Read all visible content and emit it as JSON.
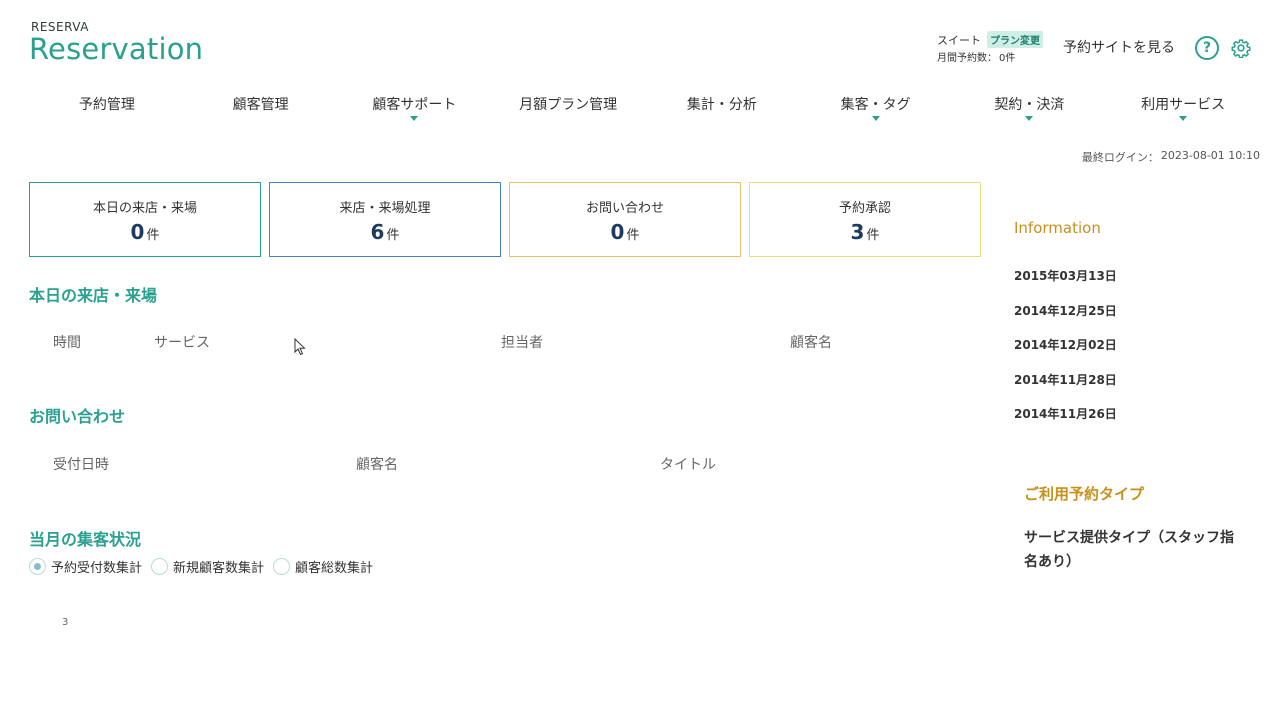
{
  "brand": {
    "small": "RESERVA",
    "big": "Reservation"
  },
  "plan": {
    "name": "スイート",
    "change_label": "プラン変更",
    "monthly_label": "月間予約数：",
    "monthly_value": "0件"
  },
  "header": {
    "view_site": "予約サイトを見る",
    "help_glyph": "?"
  },
  "nav": [
    {
      "label": "予約管理",
      "has_dropdown": false
    },
    {
      "label": "顧客管理",
      "has_dropdown": false
    },
    {
      "label": "顧客サポート",
      "has_dropdown": true
    },
    {
      "label": "月額プラン管理",
      "has_dropdown": false
    },
    {
      "label": "集計・分析",
      "has_dropdown": false
    },
    {
      "label": "集客・タグ",
      "has_dropdown": true
    },
    {
      "label": "契約・決済",
      "has_dropdown": true
    },
    {
      "label": "利用サービス",
      "has_dropdown": true
    }
  ],
  "last_login": {
    "label": "最終ログイン：",
    "value": "2023-08-01 10:10"
  },
  "cards": [
    {
      "label": "本日の来店・来場",
      "value": "0",
      "unit": "件",
      "border": "#2aa190"
    },
    {
      "label": "来店・来場処理",
      "value": "6",
      "unit": "件",
      "border": "#4a7fc1"
    },
    {
      "label": "お問い合わせ",
      "value": "0",
      "unit": "件",
      "border": "#e8c36a"
    },
    {
      "label": "予約承認",
      "value": "3",
      "unit": "件",
      "border": "#f0dc80"
    }
  ],
  "today": {
    "title": "本日の来店・来場",
    "columns": [
      "時間",
      "サービス",
      "担当者",
      "顧客名"
    ]
  },
  "inquiries": {
    "title": "お問い合わせ",
    "columns": [
      "受付日時",
      "顧客名",
      "タイトル"
    ]
  },
  "monthly_status": {
    "title": "当月の集客状況",
    "options": [
      {
        "label": "予約受付数集計",
        "checked": true
      },
      {
        "label": "新規顧客数集計",
        "checked": false
      },
      {
        "label": "顧客総数集計",
        "checked": false
      }
    ],
    "tick": "3"
  },
  "information": {
    "title": "Information",
    "dates": [
      "2015年03月13日",
      "2014年12月25日",
      "2014年12月02日",
      "2014年11月28日",
      "2014年11月26日"
    ]
  },
  "reservation_type": {
    "title": "ご利用予約タイプ",
    "value": "サービス提供タイプ（スタッフ指名あり）"
  },
  "colors": {
    "accent": "#2aa190",
    "gold": "#c8901a",
    "navy": "#1d3b5e"
  }
}
